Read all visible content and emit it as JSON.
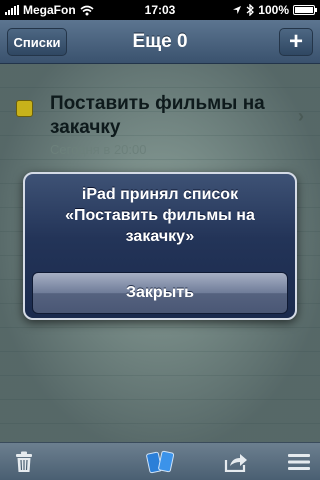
{
  "status_bar": {
    "carrier": "MegaFon",
    "time": "17:03",
    "battery": "100%"
  },
  "nav": {
    "back_label": "Списки",
    "title": "Еще 0",
    "add_label": "+"
  },
  "task": {
    "title": "Поставить фильмы на закачку",
    "subtitle": "Сегодня в 20:00",
    "check_color": "#c8b21a"
  },
  "alert": {
    "message": "iPad принял список «Поставить фильмы на закачку»",
    "button_label": "Закрыть"
  },
  "toolbar": {
    "icons": [
      "trash-icon",
      "devices-icon",
      "share-icon",
      "menu-icon"
    ]
  }
}
